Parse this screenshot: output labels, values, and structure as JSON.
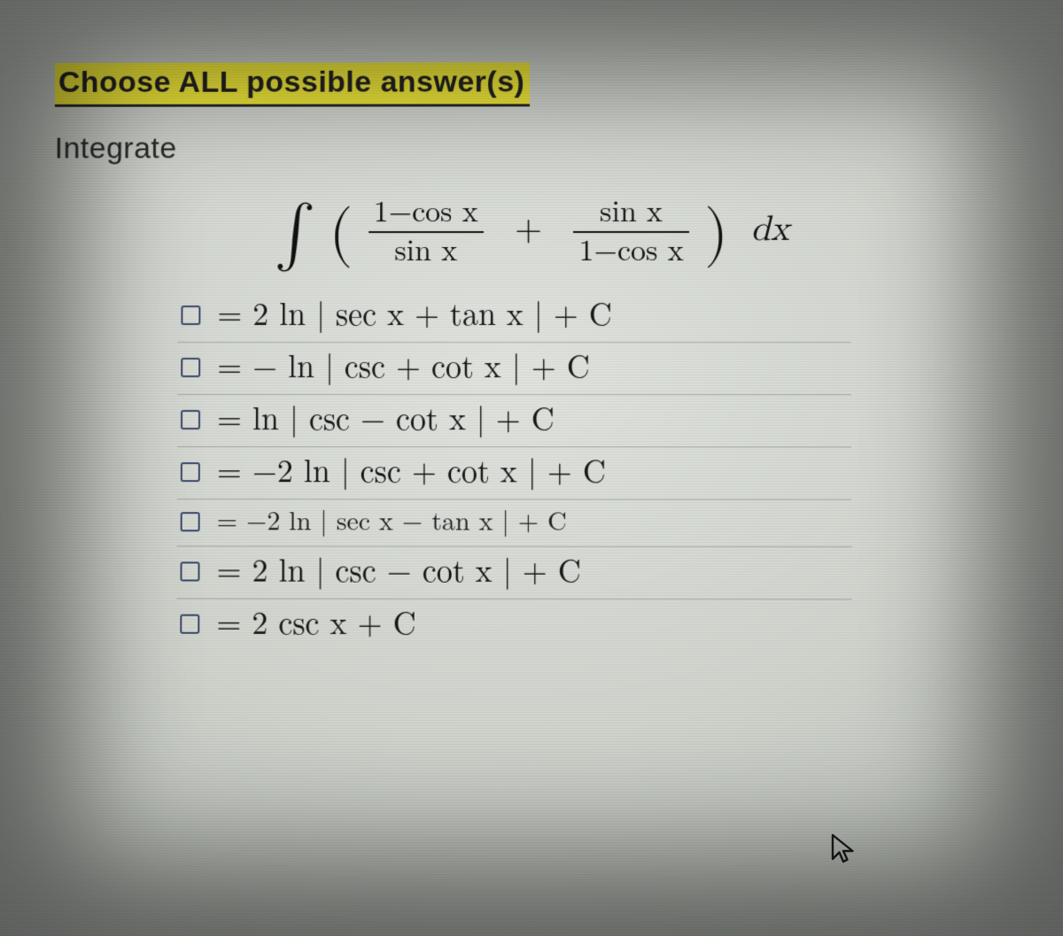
{
  "header": {
    "highlight": "Choose ALL possible answer(s)",
    "prompt": "Integrate"
  },
  "integral": {
    "int": "∫",
    "lparen": "(",
    "frac1_num": "1−cos x",
    "frac1_den": "sin x",
    "plus": "+",
    "frac2_num": "sin x",
    "frac2_den": "1−cos x",
    "rparen": ")",
    "dx": "dx"
  },
  "options": [
    {
      "text": "= 2 ln | sec x + tan x | + C",
      "small": false
    },
    {
      "text": "= − ln | csc + cot x | + C",
      "small": false
    },
    {
      "text": "= ln | csc − cot x | + C",
      "small": false
    },
    {
      "text": "= −2 ln | csc + cot x | + C",
      "small": false
    },
    {
      "text": "= −2 ln | sec x − tan x | + C",
      "small": true
    },
    {
      "text": "= 2 ln | csc − cot x | + C",
      "small": false
    },
    {
      "text": "= 2 csc x  +  C",
      "small": false
    }
  ],
  "icons": {
    "cursor": "cursor-pointer"
  }
}
